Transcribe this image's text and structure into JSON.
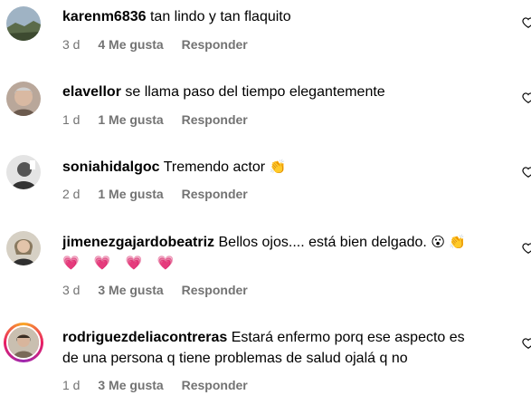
{
  "comments": [
    {
      "username": "karenm6836",
      "text": "tan lindo y tan flaquito",
      "time": "3 d",
      "likes": "4 Me gusta",
      "reply": "Responder"
    },
    {
      "username": "elavellor",
      "text": "se llama paso del tiempo elegantemente",
      "time": "1 d",
      "likes": "1 Me gusta",
      "reply": "Responder"
    },
    {
      "username": "soniahidalgoc",
      "text": "Tremendo actor",
      "emoji": "👏",
      "time": "2 d",
      "likes": "1 Me gusta",
      "reply": "Responder"
    },
    {
      "username": "jimenezgajardobeatriz",
      "text": "Bellos ojos.... está bien delgado.",
      "emoji": "😮 👏",
      "hearts": "💗 💗 💗 💗",
      "time": "3 d",
      "likes": "3 Me gusta",
      "reply": "Responder"
    },
    {
      "username": "rodriguezdeliacontreras",
      "text": "Estará enfermo porq ese aspecto es",
      "text2": "de una persona q tiene problemas de salud ojalá q no",
      "time": "1 d",
      "likes": "3 Me gusta",
      "reply": "Responder"
    }
  ],
  "icons": {
    "like": "heart-outline-icon"
  }
}
